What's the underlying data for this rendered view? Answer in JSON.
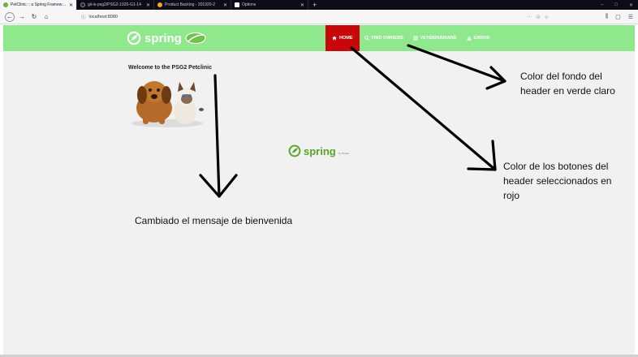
{
  "browser": {
    "tabs": [
      {
        "label": "PetClinic :: a Spring Framework demonstration",
        "active": true,
        "favicon_color": "#6db33f"
      },
      {
        "label": "gii-is-psg2/PSG2-1920-G1-14",
        "active": false,
        "favicon_color": "#24292e"
      },
      {
        "label": "Product Backlog - 201920-2",
        "active": false,
        "favicon_color": "#f5a623"
      },
      {
        "label": "Options",
        "active": false,
        "favicon_color": "#ffffff"
      }
    ],
    "new_tab": "+",
    "window_controls": [
      "–",
      "□",
      "✕"
    ],
    "url": "localhost:8080",
    "url_actions": [
      "···",
      "☉",
      "☆"
    ],
    "tools": [
      "⫼",
      "▢",
      "☰"
    ]
  },
  "header": {
    "background": "#8fe88c",
    "logo_text": "spring",
    "menu": [
      {
        "label": "Home",
        "icon": "home-icon",
        "active": true
      },
      {
        "label": "Find owners",
        "icon": "search-icon",
        "active": false
      },
      {
        "label": "Veterinarians",
        "icon": "list-icon",
        "active": false
      },
      {
        "label": "Error",
        "icon": "warning-icon",
        "active": false
      }
    ],
    "active_color": "#c8070a"
  },
  "main": {
    "welcome": "Welcome to the PSG2 Petclinic",
    "footer_logo_text": "spring",
    "footer_logo_sub": "by Pivotal."
  },
  "annotations": {
    "header_note": "Color del fondo del header en verde claro",
    "buttons_note": "Color de los botones del header seleccionados en rojo",
    "welcome_note": "Cambiado el mensaje de bienvenida"
  }
}
